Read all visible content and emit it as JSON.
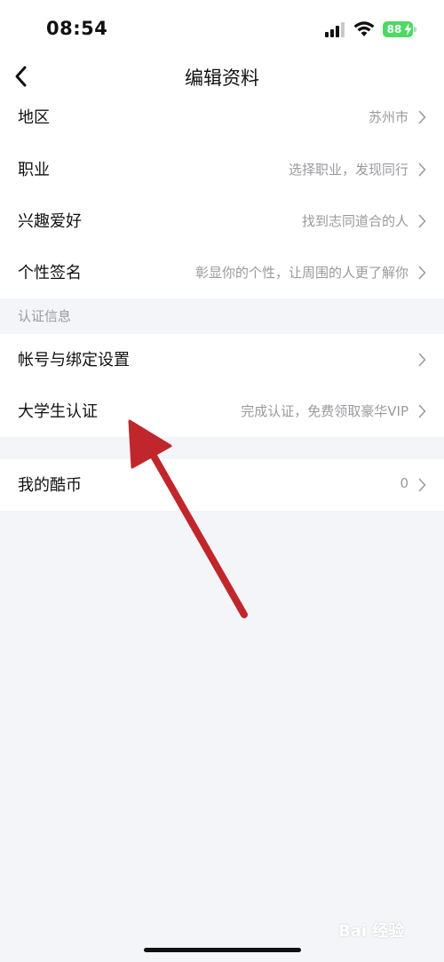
{
  "status": {
    "time": "08:54",
    "battery": "88"
  },
  "header": {
    "title": "编辑资料"
  },
  "profile_rows": [
    {
      "label": "地区",
      "value": "苏州市"
    },
    {
      "label": "职业",
      "value": "选择职业，发现同行"
    },
    {
      "label": "兴趣爱好",
      "value": "找到志同道合的人"
    },
    {
      "label": "个性签名",
      "value": "彰显你的个性，让周围的人更了解你"
    }
  ],
  "auth_section": {
    "title": "认证信息",
    "rows": [
      {
        "label": "帐号与绑定设置",
        "value": ""
      },
      {
        "label": "大学生认证",
        "value": "完成认证，免费领取豪华VIP"
      }
    ]
  },
  "coins_row": {
    "label": "我的酷币",
    "value": "0"
  },
  "watermark": "Bai 经验",
  "colors": {
    "accent_arrow": "#c0262b",
    "battery": "#4cd964",
    "secondary_text": "#9a9a9f",
    "background": "#f4f5f9"
  }
}
